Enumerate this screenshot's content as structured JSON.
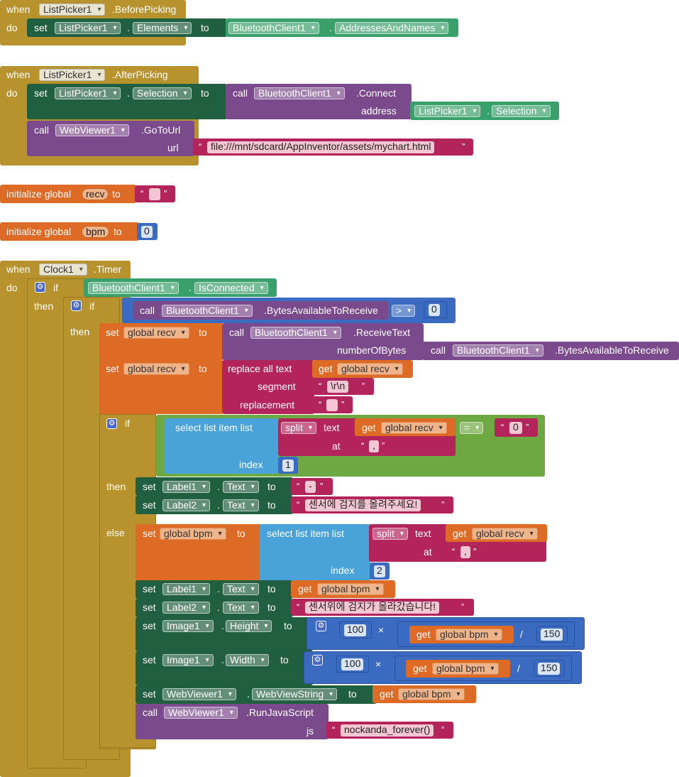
{
  "colors": {
    "event": "#b8932d",
    "setter": "#205f3f",
    "getter": "#3aa06b",
    "call": "#7b4a8c",
    "variable": "#dd6a25",
    "math": "#3a6bc0",
    "text": "#b3245a",
    "list": "#4aa3d8",
    "logic": "#6ea842"
  },
  "kw": {
    "when": "when",
    "do": "do",
    "set": "set",
    "to": "to",
    "call": "call",
    "get": "get",
    "if": "if",
    "then": "then",
    "else": "else",
    "init": "initialize global",
    "dot": "."
  },
  "b1": {
    "comp": "ListPicker1",
    "event": ".BeforePicking",
    "prop": "Elements",
    "src_comp": "BluetoothClient1",
    "src_prop": "AddressesAndNames"
  },
  "b2": {
    "comp": "ListPicker1",
    "event": ".AfterPicking",
    "prop": "Selection",
    "bt": "BluetoothClient1",
    "method": ".Connect",
    "address_label": "address",
    "addr_comp": "ListPicker1",
    "addr_prop": "Selection",
    "wv": "WebViewer1",
    "goto": ".GoToUrl",
    "url_label": "url",
    "url": "file:///mnt/sdcard/AppInventor/assets/mychart.html"
  },
  "g1": {
    "name": "recv",
    "value": ""
  },
  "g2": {
    "name": "bpm",
    "value": "0"
  },
  "timer": {
    "comp": "Clock1",
    "event": ".Timer",
    "if1_comp": "BluetoothClient1",
    "if1_prop": "IsConnected",
    "if2_comp": "BluetoothClient1",
    "if2_method": ".BytesAvailableToReceive",
    "if2_op": ">",
    "if2_val": "0",
    "r1_var": "global recv",
    "r1_comp": "BluetoothClient1",
    "r1_method": ".ReceiveText",
    "r1_arg_label": "numberOfBytes",
    "r1_arg_comp": "BluetoothClient1",
    "r1_arg_method": ".BytesAvailableToReceive",
    "r2_var": "global recv",
    "r2_op": "replace all text",
    "r2_get": "global recv",
    "r2_seg_label": "segment",
    "r2_seg": "\\r\\n",
    "r2_rep_label": "replacement",
    "r2_rep": "",
    "if3_select": "select list item  list",
    "if3_split": "split",
    "if3_text_label": "text",
    "if3_get": "global recv",
    "if3_at_label": "at",
    "if3_at": ",",
    "if3_index_label": "index",
    "if3_index": "1",
    "if3_op": "=",
    "if3_cmp": "0",
    "then_l1": "Label1",
    "then_l1_prop": "Text",
    "then_l1_val": "-",
    "then_l2": "Label2",
    "then_l2_prop": "Text",
    "then_l2_val": "센서에 검지를 올려주세요!",
    "e1_var": "global bpm",
    "e1_select": "select list item  list",
    "e1_split": "split",
    "e1_text_label": "text",
    "e1_get": "global recv",
    "e1_at_label": "at",
    "e1_at": ",",
    "e1_index_label": "index",
    "e1_index": "2",
    "e2_comp": "Label1",
    "e2_prop": "Text",
    "e2_get": "global bpm",
    "e3_comp": "Label2",
    "e3_prop": "Text",
    "e3_val": "센서위에 검지가 올라갔습니다!",
    "e4_comp": "Image1",
    "e4_prop": "Height",
    "e4_n1": "100",
    "e4_mul": "×",
    "e4_get": "global bpm",
    "e4_div": "/",
    "e4_n2": "150",
    "e5_comp": "Image1",
    "e5_prop": "Width",
    "e5_n1": "100",
    "e5_mul": "×",
    "e5_get": "global bpm",
    "e5_div": "/",
    "e5_n2": "150",
    "e6_comp": "WebViewer1",
    "e6_prop": "WebViewString",
    "e6_get": "global bpm",
    "e7_comp": "WebViewer1",
    "e7_method": ".RunJavaScript",
    "e7_label": "js",
    "e7_val": "nockanda_forever()"
  }
}
